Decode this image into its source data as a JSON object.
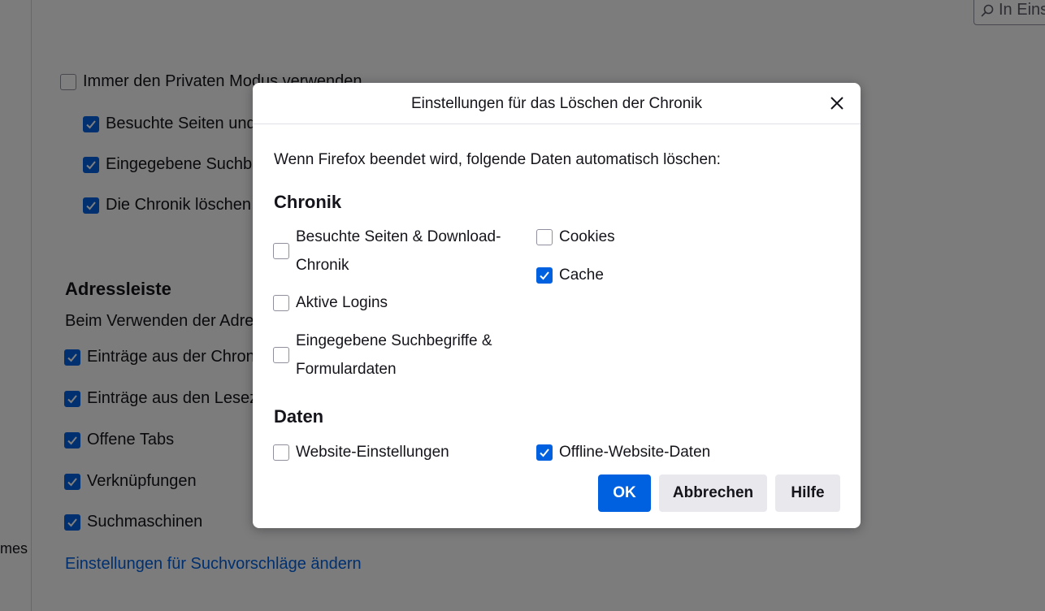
{
  "background": {
    "search_placeholder": "In Eins",
    "sidebar_fragment": "mes",
    "private_mode": {
      "label": "Immer den Privaten Modus verwenden",
      "checked": false
    },
    "history_items": [
      {
        "label": "Besuchte Seiten und",
        "checked": true
      },
      {
        "label": "Eingegebene Suchb",
        "checked": true
      },
      {
        "label": "Die Chronik löschen",
        "checked": true
      }
    ],
    "addressbar": {
      "heading": "Adressleiste",
      "description": "Beim Verwenden der Adre",
      "items": [
        {
          "label": "Einträge aus der Chron",
          "checked": true
        },
        {
          "label": "Einträge aus den Lesez",
          "checked": true
        },
        {
          "label": "Offene Tabs",
          "checked": true
        },
        {
          "label": "Verknüpfungen",
          "checked": true
        },
        {
          "label": "Suchmaschinen",
          "checked": true
        }
      ],
      "link": "Einstellungen für Suchvorschläge ändern"
    }
  },
  "dialog": {
    "title": "Einstellungen für das Löschen der Chronik",
    "description": "Wenn Firefox beendet wird, folgende Daten automatisch löschen:",
    "sections": {
      "history": {
        "heading": "Chronik",
        "options": [
          {
            "line1": "Besuchte Seiten & Download-",
            "line2": "Chronik",
            "checked": false
          },
          {
            "line1": "Aktive Logins",
            "checked": false
          },
          {
            "line1": "Eingegebene Suchbegriffe &",
            "line2": "Formulardaten",
            "checked": false
          },
          {
            "line1": "Cookies",
            "checked": false
          },
          {
            "line1": "Cache",
            "checked": true
          }
        ]
      },
      "data": {
        "heading": "Daten",
        "options": [
          {
            "line1": "Website-Einstellungen",
            "checked": false
          },
          {
            "line1": "Offline-Website-Daten",
            "checked": true
          }
        ]
      }
    },
    "buttons": {
      "ok": "OK",
      "cancel": "Abbrechen",
      "help": "Hilfe"
    }
  },
  "colors": {
    "accent": "#0061e0",
    "secondary_button": "#e9e9ed",
    "overlay": "rgba(0,0,0,0.5)"
  }
}
